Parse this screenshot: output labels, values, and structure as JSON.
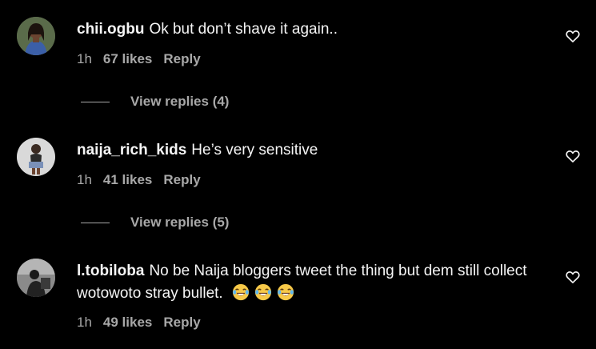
{
  "comments": [
    {
      "username": "chii.ogbu",
      "text": "Ok but don’t shave it again..",
      "time": "1h",
      "likes": "67 likes",
      "reply": "Reply",
      "view_replies": "View replies (4)"
    },
    {
      "username": "naija_rich_kids",
      "text": "He’s very sensitive",
      "time": "1h",
      "likes": "41 likes",
      "reply": "Reply",
      "view_replies": "View replies (5)"
    },
    {
      "username": "l.tobiloba",
      "text": "No be Naija bloggers tweet the thing but dem still collect wotowoto stray bullet.",
      "emojis": [
        "face-with-tears-of-joy",
        "face-with-tears-of-joy",
        "face-with-tears-of-joy"
      ],
      "time": "1h",
      "likes": "49 likes",
      "reply": "Reply"
    }
  ],
  "icons": {
    "like": "heart-outline-icon"
  },
  "colors": {
    "background": "#000000",
    "primary_text": "#f5f5f5",
    "secondary_text": "#a8a8a8"
  }
}
